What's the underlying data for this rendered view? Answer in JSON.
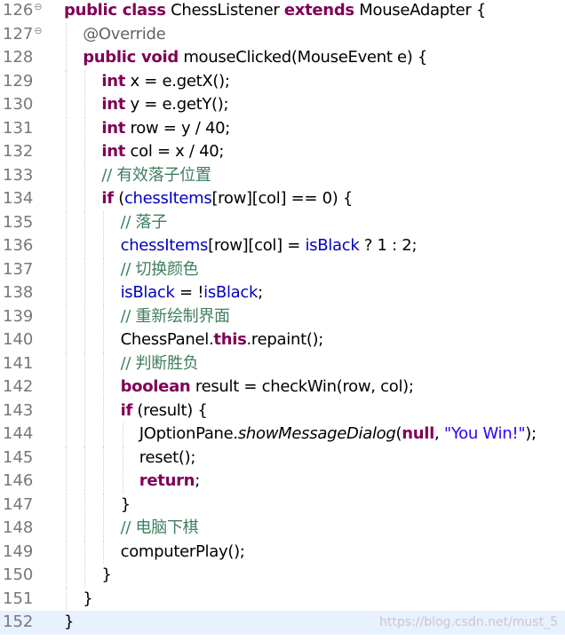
{
  "lines": [
    {
      "num": "126",
      "fold": "⊖",
      "tokens": [
        [
          "kw",
          "public class"
        ],
        [
          "",
          "ChessListener "
        ],
        [
          "kw",
          "extends"
        ],
        [
          "",
          "MouseAdapter {"
        ]
      ]
    },
    {
      "num": "127",
      "fold": "⊖",
      "tokens": [
        [
          "ann",
          "@Override"
        ]
      ]
    },
    {
      "num": "128",
      "fold": "",
      "tokens": [
        [
          "kw",
          "public void"
        ],
        [
          "",
          "mouseClicked(MouseEvent e) {"
        ]
      ]
    },
    {
      "num": "129",
      "fold": "",
      "tokens": [
        [
          "kw",
          "int"
        ],
        [
          "",
          " x = e.getX();"
        ]
      ]
    },
    {
      "num": "130",
      "fold": "",
      "tokens": [
        [
          "kw",
          "int"
        ],
        [
          "",
          " y = e.getY();"
        ]
      ]
    },
    {
      "num": "131",
      "fold": "",
      "tokens": [
        [
          "kw",
          "int"
        ],
        [
          "",
          " row = y / 40;"
        ]
      ]
    },
    {
      "num": "132",
      "fold": "",
      "tokens": [
        [
          "kw",
          "int"
        ],
        [
          "",
          " col = x / 40;"
        ]
      ]
    },
    {
      "num": "133",
      "fold": "",
      "tokens": [
        [
          "cmt",
          "// 有效落子位置"
        ]
      ]
    },
    {
      "num": "134",
      "fold": "",
      "tokens": [
        [
          "kw",
          "if"
        ],
        [
          "",
          " ("
        ],
        [
          "fld",
          "chessItems"
        ],
        [
          "",
          "[row][col] == 0) {"
        ]
      ]
    },
    {
      "num": "135",
      "fold": "",
      "tokens": [
        [
          "cmt",
          "// 落子"
        ]
      ]
    },
    {
      "num": "136",
      "fold": "",
      "tokens": [
        [
          "fld",
          "chessItems"
        ],
        [
          "",
          "[row][col] = "
        ],
        [
          "fld",
          "isBlack"
        ],
        [
          "",
          " ? 1 : 2;"
        ]
      ]
    },
    {
      "num": "137",
      "fold": "",
      "tokens": [
        [
          "cmt",
          "// 切换颜色"
        ]
      ]
    },
    {
      "num": "138",
      "fold": "",
      "tokens": [
        [
          "fld",
          "isBlack"
        ],
        [
          "",
          " = !"
        ],
        [
          "fld",
          "isBlack"
        ],
        [
          "",
          ";"
        ]
      ]
    },
    {
      "num": "139",
      "fold": "",
      "tokens": [
        [
          "cmt",
          "// 重新绘制界面"
        ]
      ]
    },
    {
      "num": "140",
      "fold": "",
      "tokens": [
        [
          "",
          "ChessPanel."
        ],
        [
          "kw",
          "this"
        ],
        [
          "",
          ".repaint();"
        ]
      ]
    },
    {
      "num": "141",
      "fold": "",
      "tokens": [
        [
          "cmt",
          "// 判断胜负"
        ]
      ]
    },
    {
      "num": "142",
      "fold": "",
      "tokens": [
        [
          "kw",
          "boolean"
        ],
        [
          "",
          " result = checkWin(row, col);"
        ]
      ]
    },
    {
      "num": "143",
      "fold": "",
      "tokens": [
        [
          "kw",
          "if"
        ],
        [
          "",
          " (result) {"
        ]
      ]
    },
    {
      "num": "144",
      "fold": "",
      "tokens": [
        [
          "",
          "JOptionPane."
        ],
        [
          "it",
          "showMessageDialog"
        ],
        [
          "",
          "("
        ],
        [
          "kw",
          "null"
        ],
        [
          "",
          ", "
        ],
        [
          "str",
          "\"You Win!\""
        ],
        [
          "",
          ");"
        ]
      ]
    },
    {
      "num": "145",
      "fold": "",
      "tokens": [
        [
          "",
          "reset();"
        ]
      ]
    },
    {
      "num": "146",
      "fold": "",
      "tokens": [
        [
          "kw",
          "return"
        ],
        [
          "",
          ";"
        ]
      ]
    },
    {
      "num": "147",
      "fold": "",
      "tokens": [
        [
          "",
          "}"
        ]
      ]
    },
    {
      "num": "148",
      "fold": "",
      "tokens": [
        [
          "cmt",
          "// 电脑下棋"
        ]
      ]
    },
    {
      "num": "149",
      "fold": "",
      "tokens": [
        [
          "",
          "computerPlay();"
        ]
      ]
    },
    {
      "num": "150",
      "fold": "",
      "tokens": [
        [
          "",
          "}"
        ]
      ]
    },
    {
      "num": "151",
      "fold": "",
      "tokens": [
        [
          "",
          "}"
        ]
      ]
    },
    {
      "num": "152",
      "fold": "",
      "tokens": [
        [
          "",
          "}"
        ]
      ]
    }
  ],
  "current_line": "152",
  "watermark": "https://blog.csdn.net/must_5",
  "colors": {
    "keyword": "#7f0055",
    "field": "#0000c0",
    "comment": "#3f7f5f",
    "string": "#2a00ff",
    "annotation": "#646464",
    "line_number": "#787878",
    "current_line_bg": "#e8f2fe"
  }
}
